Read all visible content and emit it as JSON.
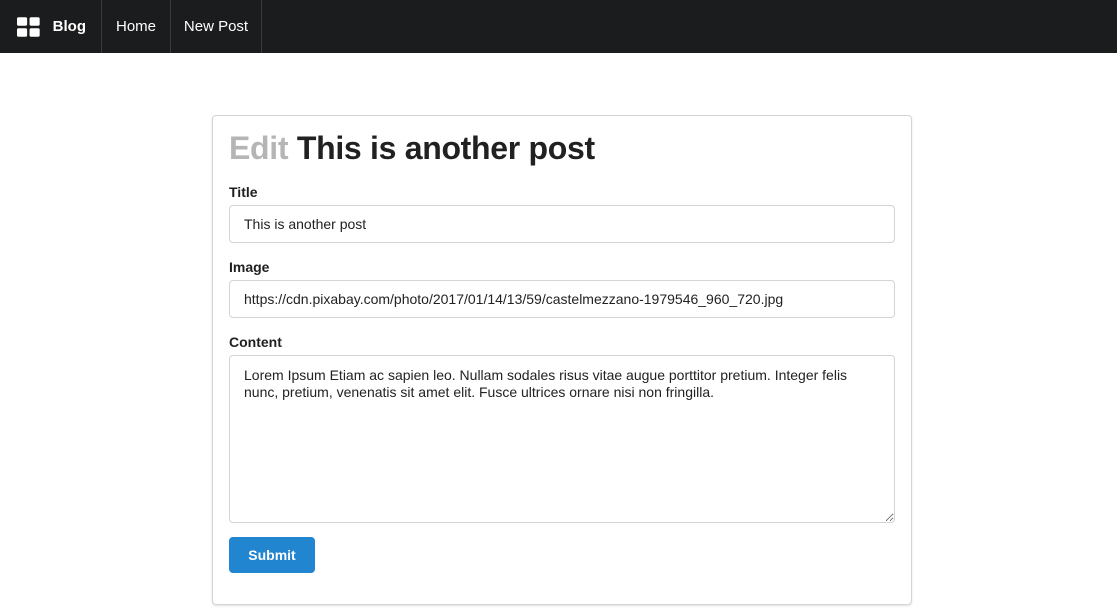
{
  "navbar": {
    "brand_label": "Blog",
    "brand_icon": "grid-icon",
    "items": [
      {
        "label": "Home"
      },
      {
        "label": "New Post"
      }
    ]
  },
  "form": {
    "heading_prefix": "Edit",
    "heading_title": "This is another post",
    "title_label": "Title",
    "title_value": "This is another post",
    "image_label": "Image",
    "image_value": "https://cdn.pixabay.com/photo/2017/01/14/13/59/castelmezzano-1979546_960_720.jpg",
    "content_label": "Content",
    "content_value": "Lorem Ipsum Etiam ac sapien leo. Nullam sodales risus vitae augue porttitor pretium. Integer felis nunc, pretium, venenatis sit amet elit. Fusce ultrices ornare nisi non fringilla.",
    "submit_label": "Submit"
  },
  "colors": {
    "navbar_bg": "#1b1c1d",
    "submit_bg": "#2185d0",
    "heading_muted": "#b5b5b5"
  }
}
